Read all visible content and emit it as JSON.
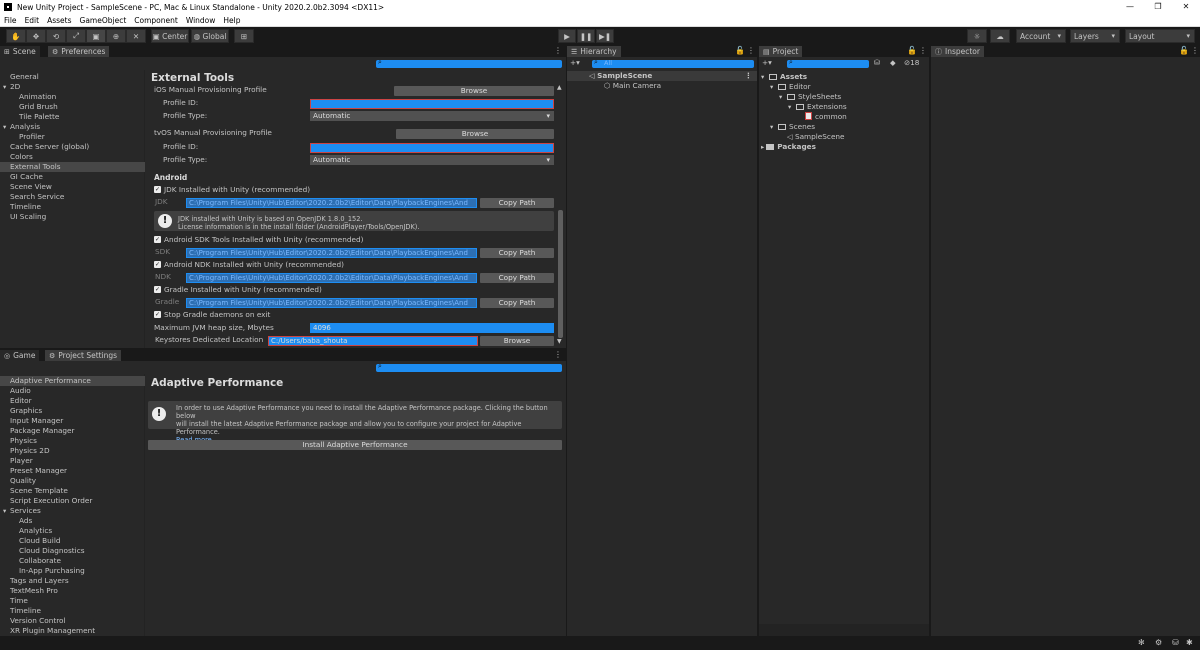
{
  "window": {
    "title": "New Unity Project - SampleScene - PC, Mac & Linux Standalone - Unity 2020.2.0b2.3094 <DX11>",
    "controls": [
      "—",
      "❐",
      "✕"
    ]
  },
  "menu": [
    "File",
    "Edit",
    "Assets",
    "GameObject",
    "Component",
    "Window",
    "Help"
  ],
  "toolbar": {
    "center_label": "Center",
    "global_label": "Global",
    "account_label": "Account",
    "layers_label": "Layers",
    "layout_label": "Layout"
  },
  "top_left_panel": {
    "tabs": [
      {
        "label": "Scene"
      },
      {
        "label": "Preferences"
      }
    ],
    "categories": [
      {
        "label": "General",
        "indent": 0
      },
      {
        "label": "2D",
        "indent": 0,
        "fold": true
      },
      {
        "label": "Animation",
        "indent": 1
      },
      {
        "label": "Grid Brush",
        "indent": 1
      },
      {
        "label": "Tile Palette",
        "indent": 1
      },
      {
        "label": "Analysis",
        "indent": 0,
        "fold": true
      },
      {
        "label": "Profiler",
        "indent": 1
      },
      {
        "label": "Cache Server (global)",
        "indent": 0
      },
      {
        "label": "Colors",
        "indent": 0
      },
      {
        "label": "External Tools",
        "indent": 0,
        "selected": true
      },
      {
        "label": "GI Cache",
        "indent": 0
      },
      {
        "label": "Scene View",
        "indent": 0
      },
      {
        "label": "Search Service",
        "indent": 0
      },
      {
        "label": "Timeline",
        "indent": 0
      },
      {
        "label": "UI Scaling",
        "indent": 0
      }
    ],
    "content": {
      "title": "External Tools",
      "ios_label": "iOS Manual Provisioning Profile",
      "browse": "Browse",
      "profile_id": "Profile ID:",
      "profile_type": "Profile Type:",
      "automatic": "Automatic",
      "tvos_label": "tvOS Manual Provisioning Profile",
      "android": "Android",
      "jdk_check": "JDK Installed with Unity (recommended)",
      "jdk": "JDK",
      "path": "C:\\Program Files\\Unity\\Hub\\Editor\\2020.2.0b2\\Editor\\Data\\PlaybackEngines\\And",
      "copy_path": "Copy Path",
      "jdk_info_1": "JDK installed with Unity is based on OpenJDK 1.8.0_152.",
      "jdk_info_2": "License information is in the install folder (AndroidPlayer/Tools/OpenJDK).",
      "sdk_check": "Android SDK Tools Installed with Unity (recommended)",
      "sdk": "SDK",
      "ndk_check": "Android NDK Installed with Unity (recommended)",
      "ndk": "NDK",
      "gradle_check": "Gradle Installed with Unity (recommended)",
      "gradle": "Gradle",
      "stop_gradle": "Stop Gradle daemons on exit",
      "jvm_heap": "Maximum JVM heap size, Mbytes",
      "jvm_value": "4096",
      "keystores": "Keystores Dedicated Location",
      "keystores_value": "C:/Users/baba_shouta"
    }
  },
  "bottom_left_panel": {
    "tabs": [
      {
        "label": "Game"
      },
      {
        "label": "Project Settings"
      }
    ],
    "categories": [
      {
        "label": "Adaptive Performance",
        "indent": 0,
        "selected": true
      },
      {
        "label": "Audio",
        "indent": 0
      },
      {
        "label": "Editor",
        "indent": 0
      },
      {
        "label": "Graphics",
        "indent": 0
      },
      {
        "label": "Input Manager",
        "indent": 0
      },
      {
        "label": "Package Manager",
        "indent": 0
      },
      {
        "label": "Physics",
        "indent": 0
      },
      {
        "label": "Physics 2D",
        "indent": 0
      },
      {
        "label": "Player",
        "indent": 0
      },
      {
        "label": "Preset Manager",
        "indent": 0
      },
      {
        "label": "Quality",
        "indent": 0
      },
      {
        "label": "Scene Template",
        "indent": 0
      },
      {
        "label": "Script Execution Order",
        "indent": 0
      },
      {
        "label": "Services",
        "indent": 0,
        "fold": true
      },
      {
        "label": "Ads",
        "indent": 1
      },
      {
        "label": "Analytics",
        "indent": 1
      },
      {
        "label": "Cloud Build",
        "indent": 1
      },
      {
        "label": "Cloud Diagnostics",
        "indent": 1
      },
      {
        "label": "Collaborate",
        "indent": 1
      },
      {
        "label": "In-App Purchasing",
        "indent": 1
      },
      {
        "label": "Tags and Layers",
        "indent": 0
      },
      {
        "label": "TextMesh Pro",
        "indent": 0
      },
      {
        "label": "Time",
        "indent": 0
      },
      {
        "label": "Timeline",
        "indent": 0
      },
      {
        "label": "Version Control",
        "indent": 0
      },
      {
        "label": "XR Plugin Management",
        "indent": 0
      }
    ],
    "content": {
      "title": "Adaptive Performance",
      "info_1": "In order to use Adaptive Performance you need to install the Adaptive Performance package. Clicking the button below",
      "info_2": "will install the latest Adaptive Performance package and allow you to configure your project for Adaptive Performance.",
      "read_more": "Read more",
      "install_button": "Install Adaptive Performance"
    }
  },
  "hierarchy": {
    "tab": "Hierarchy",
    "search_placeholder": "All",
    "scene": "SampleScene",
    "camera": "Main Camera"
  },
  "project": {
    "tab": "Project",
    "hidden_count": "18",
    "tree": {
      "assets": "Assets",
      "editor": "Editor",
      "stylesheets": "StyleSheets",
      "extensions": "Extensions",
      "common": "common",
      "scenes": "Scenes",
      "samplescene": "SampleScene",
      "packages": "Packages"
    }
  },
  "inspector": {
    "tab": "Inspector"
  }
}
